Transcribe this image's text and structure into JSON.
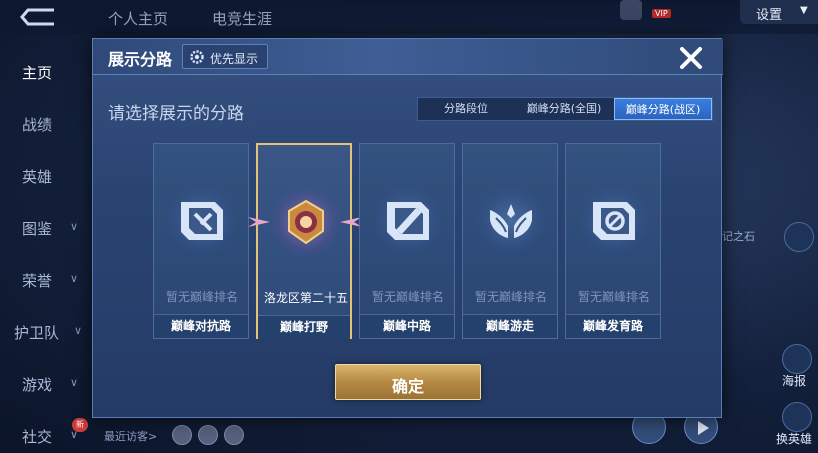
{
  "background": {
    "tabs": [
      "个人主页",
      "电竞生涯"
    ],
    "settings_label": "设置",
    "vip_label": "VIP",
    "side_nav": [
      {
        "label": "主页",
        "active": true
      },
      {
        "label": "战绩"
      },
      {
        "label": "英雄"
      },
      {
        "label": "图鉴",
        "chevron": true
      },
      {
        "label": "荣誉",
        "chevron": true
      },
      {
        "label": "护卫队",
        "chevron": true
      },
      {
        "label": "游戏",
        "chevron": true
      },
      {
        "label": "社交",
        "chevron": true,
        "badge": "新"
      }
    ],
    "recent_visitors": "最近访客>",
    "right_labels": [
      "海报",
      "换英雄"
    ],
    "right_partial": "记之石"
  },
  "modal": {
    "title": "展示分路",
    "priority_button": "优先显示",
    "section_title": "请选择展示的分路",
    "segments": [
      {
        "label": "分路段位",
        "active": false
      },
      {
        "label": "巅峰分路(全国)",
        "active": false
      },
      {
        "label": "巅峰分路(战区)",
        "active": true
      }
    ],
    "cards": [
      {
        "rank": "暂无巅峰排名",
        "lane": "巅峰对抗路",
        "icon": "sword-shield-icon",
        "selected": false
      },
      {
        "rank": "洛龙区第二十五",
        "lane": "巅峰打野",
        "icon": "jungle-emblem-icon",
        "selected": true
      },
      {
        "rank": "暂无巅峰排名",
        "lane": "巅峰中路",
        "icon": "mid-lane-icon",
        "selected": false
      },
      {
        "rank": "暂无巅峰排名",
        "lane": "巅峰游走",
        "icon": "wings-icon",
        "selected": false
      },
      {
        "rank": "暂无巅峰排名",
        "lane": "巅峰发育路",
        "icon": "marksman-icon",
        "selected": false
      }
    ],
    "confirm_button": "确定"
  },
  "colors": {
    "accent_blue": "#3a7ee0",
    "gold": "#d9b46e",
    "selected_border": "#e2c37a"
  }
}
